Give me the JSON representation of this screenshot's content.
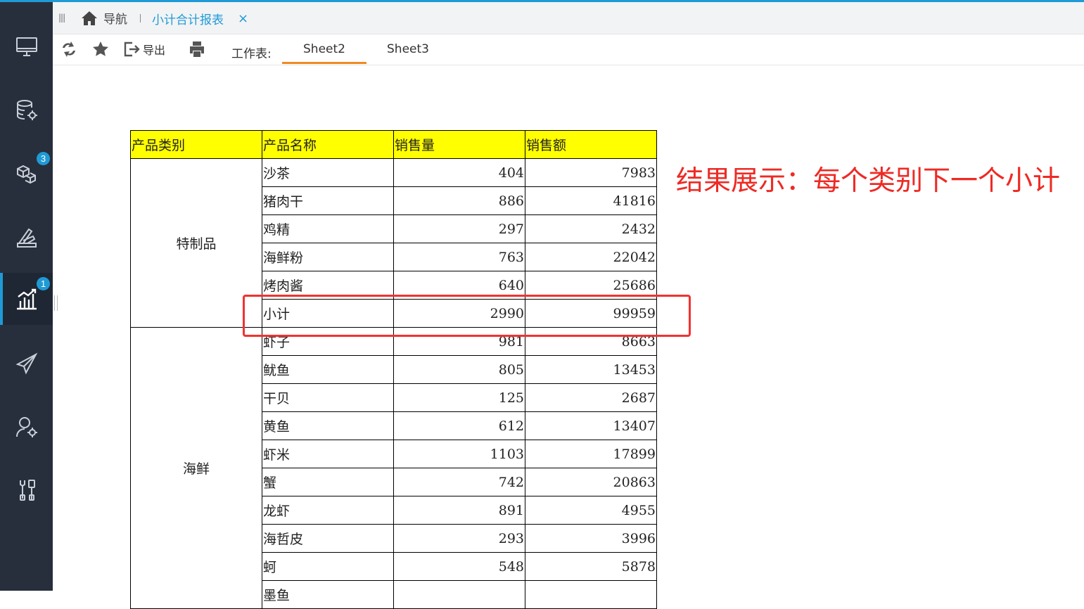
{
  "tabbar": {
    "home_label": "导航",
    "active_tab": "小计合计报表",
    "close_glyph": "×"
  },
  "sidebar": {
    "items": [
      {
        "icon": "monitor-icon",
        "badge": ""
      },
      {
        "icon": "database-gear-icon",
        "badge": ""
      },
      {
        "icon": "cubes-icon",
        "badge": "3"
      },
      {
        "icon": "pen-ruler-icon",
        "badge": ""
      },
      {
        "icon": "bar-chart-icon",
        "badge": "1",
        "active": true
      },
      {
        "icon": "paper-plane-icon",
        "badge": ""
      },
      {
        "icon": "user-gear-icon",
        "badge": ""
      },
      {
        "icon": "tools-icon",
        "badge": ""
      }
    ],
    "colors": {
      "bg": "#272f3d",
      "accent": "#1f9ad6"
    }
  },
  "toolbar": {
    "export_label": "导出",
    "worksheet_label": "工作表:",
    "sheets": [
      "Sheet2",
      "Sheet3"
    ],
    "active_sheet": "Sheet2"
  },
  "report": {
    "headers": [
      "产品类别",
      "产品名称",
      "销售量",
      "销售额"
    ],
    "groups": [
      {
        "category": "特制品",
        "rows": [
          [
            "沙茶",
            "404",
            "7983"
          ],
          [
            "猪肉干",
            "886",
            "41816"
          ],
          [
            "鸡精",
            "297",
            "2432"
          ],
          [
            "海鲜粉",
            "763",
            "22042"
          ],
          [
            "烤肉酱",
            "640",
            "25686"
          ],
          [
            "小计",
            "2990",
            "99959"
          ]
        ]
      },
      {
        "category": "海鲜",
        "rows": [
          [
            "虾子",
            "981",
            "8663"
          ],
          [
            "鱿鱼",
            "805",
            "13453"
          ],
          [
            "干贝",
            "125",
            "2687"
          ],
          [
            "黄鱼",
            "612",
            "13407"
          ],
          [
            "虾米",
            "1103",
            "17899"
          ],
          [
            "蟹",
            "742",
            "20863"
          ],
          [
            "龙虾",
            "891",
            "4955"
          ],
          [
            "海哲皮",
            "293",
            "3996"
          ],
          [
            "蚵",
            "548",
            "5878"
          ],
          [
            "墨鱼",
            "",
            ""
          ]
        ]
      }
    ],
    "header_color": "#ffff00"
  },
  "annotation": {
    "text": "结果展示：每个类别下一个小计",
    "color": "#ee2a24"
  }
}
